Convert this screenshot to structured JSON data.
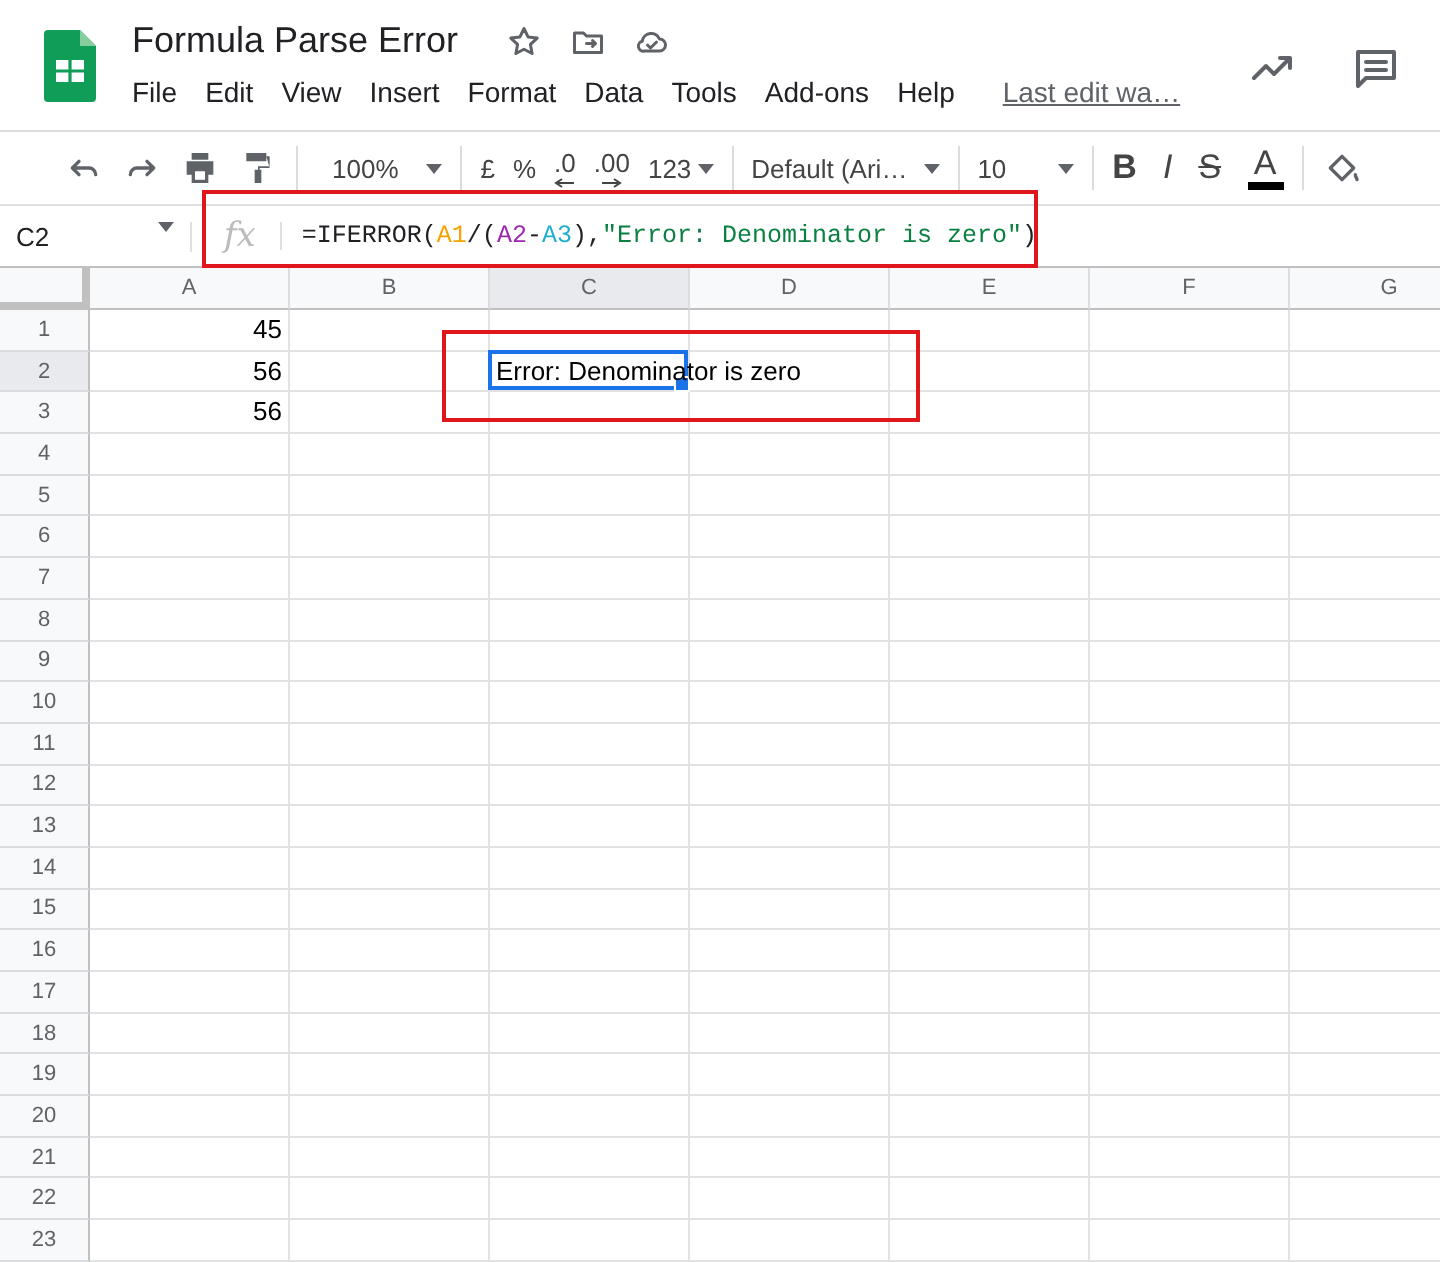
{
  "document": {
    "title": "Formula Parse Error",
    "menu": [
      "File",
      "Edit",
      "View",
      "Insert",
      "Format",
      "Data",
      "Tools",
      "Add-ons",
      "Help"
    ],
    "last_edit": "Last edit wa…"
  },
  "toolbar": {
    "zoom": "100%",
    "currency": "£",
    "percent": "%",
    "decrease_decimals": ".0",
    "increase_decimals": ".00",
    "more_formats": "123",
    "font": "Default (Ari…",
    "font_size": "10",
    "bold": "B",
    "italic": "I",
    "strikethrough": "S",
    "text_color": "A"
  },
  "formula_bar": {
    "cell_ref": "C2",
    "fx": "fx",
    "tokens": [
      {
        "text": "=IFERROR(",
        "color": "#202124"
      },
      {
        "text": "A1",
        "color": "#f4a300"
      },
      {
        "text": "/(",
        "color": "#202124"
      },
      {
        "text": "A2",
        "color": "#9c27b0"
      },
      {
        "text": "-",
        "color": "#202124"
      },
      {
        "text": "A3",
        "color": "#1eb1cf"
      },
      {
        "text": "),",
        "color": "#202124"
      },
      {
        "text": "\"Error: Denominator is zero\"",
        "color": "#0b8043"
      },
      {
        "text": ")",
        "color": "#202124"
      }
    ]
  },
  "columns": [
    {
      "label": "A",
      "selected": false
    },
    {
      "label": "B",
      "selected": false
    },
    {
      "label": "C",
      "selected": true
    },
    {
      "label": "D",
      "selected": false
    },
    {
      "label": "E",
      "selected": false
    },
    {
      "label": "F",
      "selected": false
    },
    {
      "label": "G",
      "selected": false
    }
  ],
  "rows": [
    {
      "label": "1",
      "selected": false,
      "cells": [
        {
          "text": "45",
          "kind": "number",
          "selected": false
        }
      ]
    },
    {
      "label": "2",
      "selected": true,
      "cells": [
        {
          "text": "56",
          "kind": "number",
          "selected": false
        },
        null,
        {
          "text": "Error: Denominator is zero",
          "kind": "text",
          "selected": true
        }
      ]
    },
    {
      "label": "3",
      "selected": false,
      "cells": [
        {
          "text": "56",
          "kind": "number",
          "selected": false
        }
      ]
    },
    {
      "label": "4",
      "selected": false
    },
    {
      "label": "5",
      "selected": false
    },
    {
      "label": "6",
      "selected": false
    },
    {
      "label": "7",
      "selected": false
    },
    {
      "label": "8",
      "selected": false
    },
    {
      "label": "9",
      "selected": false
    },
    {
      "label": "10",
      "selected": false
    },
    {
      "label": "11",
      "selected": false
    },
    {
      "label": "12",
      "selected": false
    },
    {
      "label": "13",
      "selected": false
    },
    {
      "label": "14",
      "selected": false
    },
    {
      "label": "15",
      "selected": false
    },
    {
      "label": "16",
      "selected": false
    },
    {
      "label": "17",
      "selected": false
    },
    {
      "label": "18",
      "selected": false
    },
    {
      "label": "19",
      "selected": false
    },
    {
      "label": "20",
      "selected": false
    },
    {
      "label": "21",
      "selected": false
    },
    {
      "label": "22",
      "selected": false
    },
    {
      "label": "23",
      "selected": false
    }
  ]
}
